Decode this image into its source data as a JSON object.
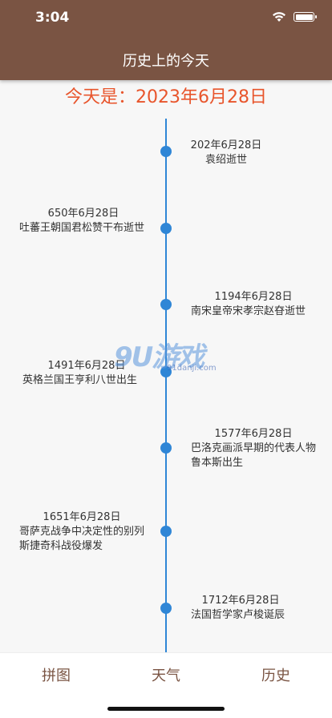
{
  "status_bar": {
    "time": "3:04"
  },
  "header": {
    "title": "历史上的今天"
  },
  "today_label": "今天是：2023年6月28日",
  "events": [
    {
      "date": "202年6月28日",
      "text": "袁绍逝世"
    },
    {
      "date": "650年6月28日",
      "text": "吐蕃王朝国君松赞干布逝世"
    },
    {
      "date": "1194年6月28日",
      "text": "南宋皇帝宋孝宗赵昚逝世"
    },
    {
      "date": "1491年6月28日",
      "text": "英格兰国王亨利八世出生"
    },
    {
      "date": "1577年6月28日",
      "text": "巴洛克画派早期的代表人物鲁本斯出生"
    },
    {
      "date": "1651年6月28日",
      "text": "哥萨克战争中决定性的别列斯捷奇科战役爆发"
    },
    {
      "date": "1712年6月28日",
      "text": "法国哲学家卢梭诞辰"
    }
  ],
  "watermark": {
    "logo": "9U游戏",
    "url": "91danji.com"
  },
  "tabs": [
    {
      "label": "拼图"
    },
    {
      "label": "天气"
    },
    {
      "label": "历史"
    }
  ],
  "colors": {
    "header": "#7a5443",
    "accent": "#e8552c",
    "timeline": "#2f86d6"
  }
}
